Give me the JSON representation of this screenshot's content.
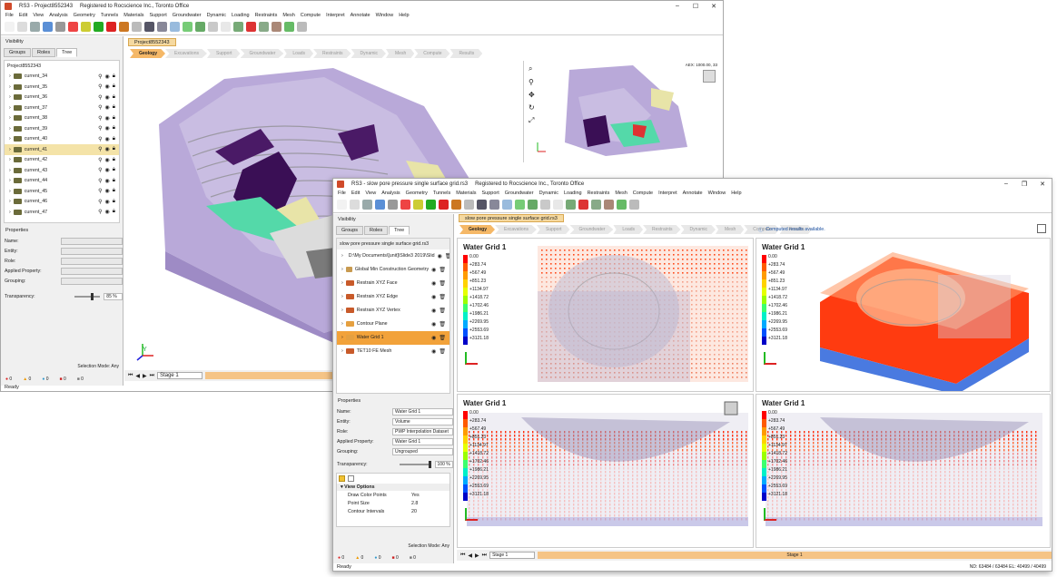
{
  "back": {
    "title": "RS3 - Project8552343",
    "reg": "Registered to Rocscience Inc., Toronto Office",
    "menu": [
      "File",
      "Edit",
      "View",
      "Analysis",
      "Geometry",
      "Tunnels",
      "Materials",
      "Support",
      "Groundwater",
      "Dynamic",
      "Loading",
      "Restraints",
      "Mesh",
      "Compute",
      "Interpret",
      "Annotate",
      "Window",
      "Help"
    ],
    "visibility": "Visibility",
    "tabs": [
      "Groups",
      "Roles",
      "Tree"
    ],
    "doc_tab": "Project8552343",
    "workflow": [
      "Geology",
      "Excavations",
      "Support",
      "Groundwater",
      "Loads",
      "Restraints",
      "Dynamic",
      "Mesh",
      "Compute",
      "Results"
    ],
    "tree_root": "Project8552343",
    "tree_items": [
      "current_34",
      "current_35",
      "current_36",
      "current_37",
      "current_38",
      "current_39",
      "current_40",
      "current_41",
      "current_42",
      "current_43",
      "current_44",
      "current_45",
      "current_46",
      "current_47"
    ],
    "properties": "Properties",
    "prop_labels": [
      "Name:",
      "Entity:",
      "Role:",
      "Applied Property:",
      "Grouping:"
    ],
    "transparency_label": "Transparency:",
    "transparency_value": "85 %",
    "selection_mode": "Selection Mode: Any",
    "stage": "Stage 1",
    "ready": "Ready",
    "status_counts": [
      "0",
      "0",
      "0",
      "0",
      "0"
    ],
    "coord": "AEX: 1000.00, 33"
  },
  "front": {
    "title": "RS3 - slow pore pressure single surface grid.rs3",
    "reg": "Registered to Rocscience Inc., Toronto Office",
    "menu": [
      "File",
      "Edit",
      "View",
      "Analysis",
      "Geometry",
      "Tunnels",
      "Materials",
      "Support",
      "Groundwater",
      "Dynamic",
      "Loading",
      "Restraints",
      "Mesh",
      "Compute",
      "Interpret",
      "Annotate",
      "Window",
      "Help"
    ],
    "visibility": "Visibility",
    "tabs": [
      "Groups",
      "Roles",
      "Tree"
    ],
    "doc_tab": "slow pore pressure single surface grid.rs3",
    "workflow": [
      "Geology",
      "Excavations",
      "Support",
      "Groundwater",
      "Loads",
      "Restraints",
      "Dynamic",
      "Mesh",
      "Compute",
      "Results"
    ],
    "computed": "Computed results available.",
    "tree_root": "slow pore pressure single surface grid.rs3",
    "tree_items": [
      {
        "label": "D:\\My Documents\\[unit]\\Slide3 2019\\Slid",
        "color": "#6b6b3a"
      },
      {
        "label": "Global Min Construction Geometry",
        "color": "#c89a50"
      },
      {
        "label": "Restrain XYZ Face",
        "color": "#c85a2a"
      },
      {
        "label": "Restrain XYZ Edge",
        "color": "#c85a2a"
      },
      {
        "label": "Restrain XYZ Vertex",
        "color": "#c85a2a"
      },
      {
        "label": "Contour Plane",
        "color": "#e5a040"
      },
      {
        "label": "Water Grid 1",
        "color": "#e5a040"
      },
      {
        "label": "TET10 FE Mesh",
        "color": "#c85a2a"
      }
    ],
    "properties": "Properties",
    "props": [
      {
        "label": "Name:",
        "value": "Water Grid 1"
      },
      {
        "label": "Entity:",
        "value": "Volume"
      },
      {
        "label": "Role:",
        "value": "PWP Interpolation Dataset"
      },
      {
        "label": "Applied Property:",
        "value": "Water Grid 1"
      },
      {
        "label": "Grouping:",
        "value": "Ungrouped"
      }
    ],
    "transparency_label": "Transparency:",
    "transparency_value": "100 %",
    "view_options": "View Options",
    "options": [
      {
        "label": "Draw Color Points",
        "value": "Yes"
      },
      {
        "label": "Point Size",
        "value": "2.8"
      },
      {
        "label": "Contour Intervals",
        "value": "20"
      }
    ],
    "selection_mode": "Selection Mode: Any",
    "stage": "Stage 1",
    "stage_bar": "Stage 1",
    "ready": "Ready",
    "status_counts": [
      "0",
      "0",
      "0",
      "0",
      "0"
    ],
    "coords": "ND: 63484 / 63484   EL: 40499 / 40499"
  },
  "legend": {
    "title": "Water Grid 1",
    "values": [
      "0.00",
      "+283.74",
      "+567.49",
      "+851.23",
      "+1134.97",
      "+1418.72",
      "+1702.46",
      "+1986.21",
      "+2269.95",
      "+2553.69",
      "+3121.18"
    ],
    "colors": [
      "#ff0000",
      "#ff5a00",
      "#ff9b00",
      "#ffd200",
      "#e6ff00",
      "#9bff00",
      "#3cff6e",
      "#00f0c8",
      "#00aaff",
      "#0050ff",
      "#0000c8"
    ]
  }
}
